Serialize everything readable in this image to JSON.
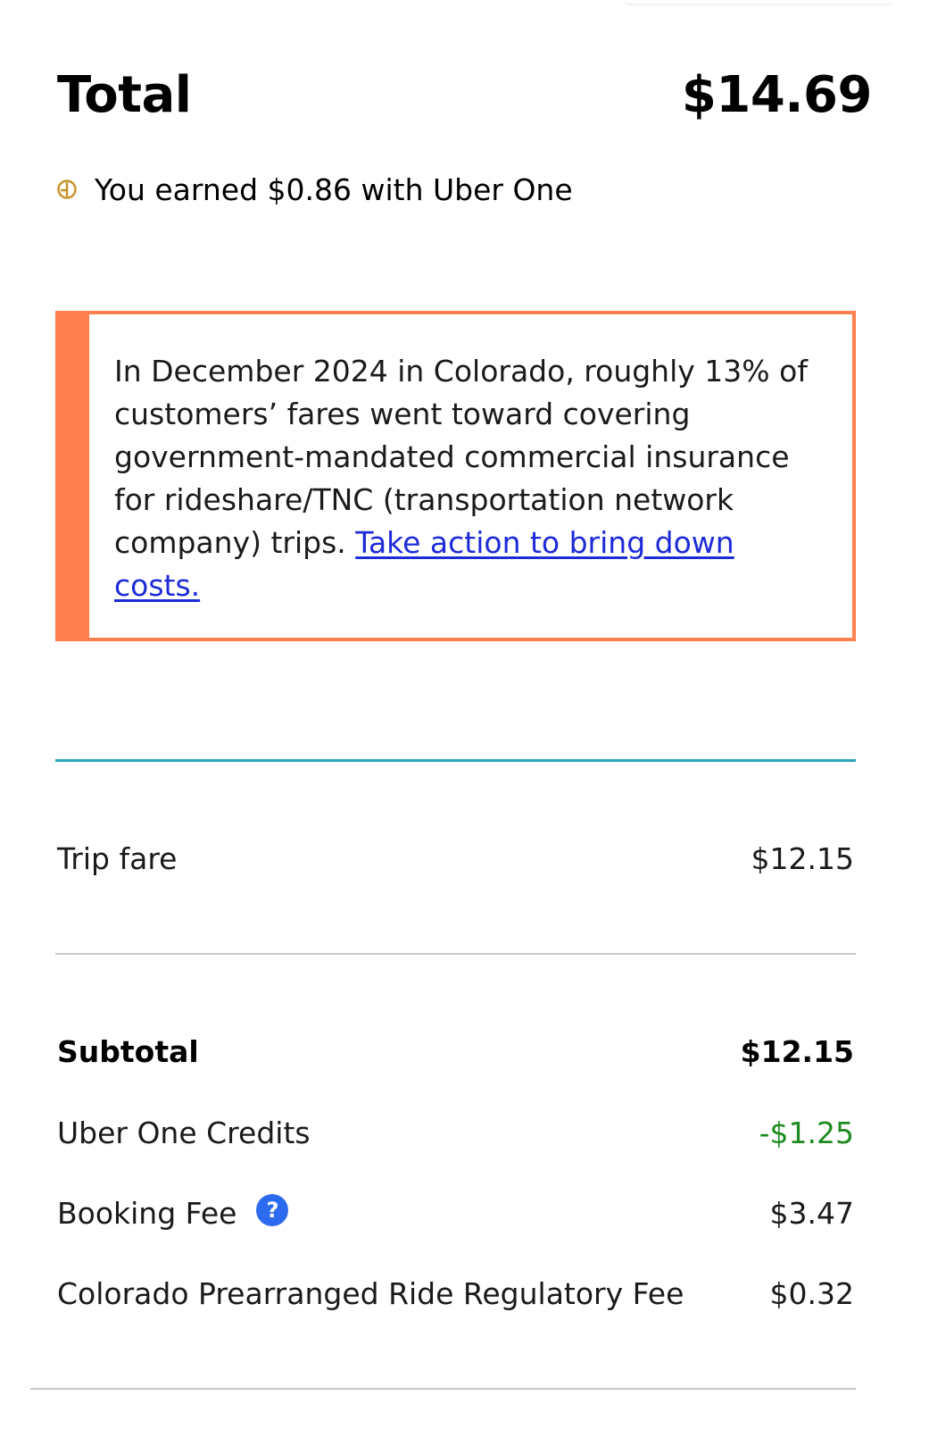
{
  "total": {
    "label": "Total",
    "value": "$14.69"
  },
  "uber_one": {
    "earned_text": "You earned $0.86 with Uber One",
    "icon": "uber-one-coin-icon",
    "icon_color": "#c8922a"
  },
  "notice": {
    "text": "In December 2024 in Colorado, roughly 13% of customers’ fares went toward covering government-mandated commercial insurance for rideshare/TNC (transportation network company) trips. ",
    "link_text": "Take action to bring down costs.",
    "accent_color": "#ff7f4f"
  },
  "line_items": {
    "trip_fare": {
      "label": "Trip fare",
      "value": "$12.15"
    },
    "subtotal": {
      "label": "Subtotal",
      "value": "$12.15"
    },
    "uber_one_credits": {
      "label": "Uber One Credits",
      "value": "-$1.25",
      "value_color": "#1f8a1f"
    },
    "booking_fee": {
      "label": "Booking Fee",
      "value": "$3.47",
      "help_icon": "?"
    },
    "regulatory_fee": {
      "label": "Colorado Prearranged Ride Regulatory Fee",
      "value": "$0.32"
    }
  }
}
